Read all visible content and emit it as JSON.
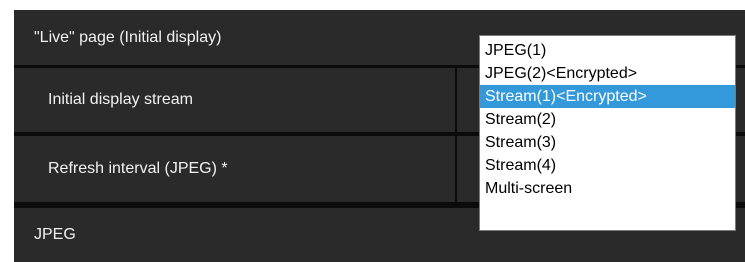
{
  "live_page": {
    "section_title": "\"Live\" page (Initial display)",
    "initial_display_stream": {
      "label": "Initial display stream",
      "selected": "Stream(1)<Encrypted>"
    },
    "refresh_interval": {
      "label": "Refresh interval (JPEG) *"
    }
  },
  "jpeg_section": {
    "title": "JPEG"
  },
  "dropdown": {
    "options": [
      "JPEG(1)",
      "JPEG(2)<Encrypted>",
      "Stream(1)<Encrypted>",
      "Stream(2)",
      "Stream(3)",
      "Stream(4)",
      "Multi-screen"
    ],
    "selected_index": 2
  },
  "colors": {
    "panel_bg": "#0c0c0c",
    "row_bg": "#2a2a2a",
    "row_text": "#f2f2f2",
    "selection_bg": "#3399db"
  }
}
